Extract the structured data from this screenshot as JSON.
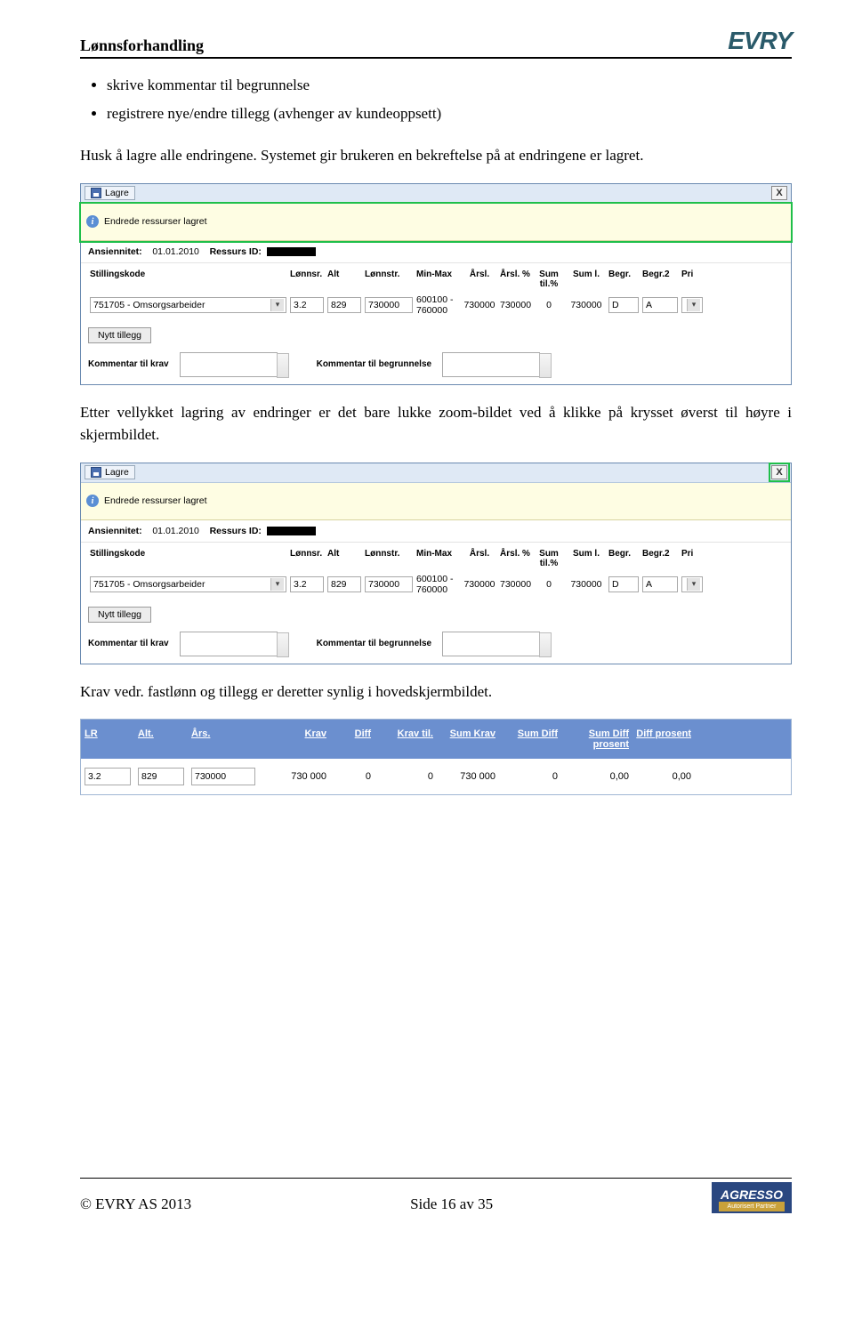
{
  "header": {
    "title": "Lønnsforhandling",
    "logo": "EVRY"
  },
  "bullets": [
    "skrive kommentar til begrunnelse",
    "registrere nye/endre tillegg (avhenger av kundeoppsett)"
  ],
  "paragraphs": {
    "p1": "Husk å lagre alle endringene. Systemet gir brukeren en bekreftelse på at endringene er lagret.",
    "p2": "Etter vellykket lagring av endringer er det bare lukke zoom-bildet ved å klikke på krysset øverst til høyre i skjermbildet.",
    "p3": "Krav vedr. fastlønn og tillegg er deretter synlig i hovedskjermbildet."
  },
  "app": {
    "lagre_label": "Lagre",
    "close_label": "X",
    "msg": "Endrede ressurser lagret",
    "meta": {
      "ansiennitet_label": "Ansiennitet:",
      "ansiennitet_value": "01.01.2010",
      "ressursid_label": "Ressurs ID:"
    },
    "headers": {
      "stillingskode": "Stillingskode",
      "lonnsr": "Lønnsr.",
      "alt": "Alt",
      "lonnstr": "Lønnstr.",
      "minmax": "Min-Max",
      "arsl": "Årsl.",
      "arslp": "Årsl. %",
      "sumtil": "Sum til.%",
      "suml": "Sum l.",
      "begr": "Begr.",
      "begr2": "Begr.2",
      "pri": "Pri"
    },
    "row": {
      "stillingskode": "751705 - Omsorgsarbeider",
      "lonnsr": "3.2",
      "alt": "829",
      "lonnstr": "730000",
      "minmax": "600100 - 760000",
      "arsl": "730000",
      "arslp": "730000",
      "sumtil": "0",
      "suml": "730000",
      "begr": "D",
      "begr2": "A"
    },
    "nytt_tillegg": "Nytt tillegg",
    "kommentar_krav_label": "Kommentar til krav",
    "kommentar_begr_label": "Kommentar til begrunnelse"
  },
  "bluetable": {
    "headers": {
      "lr": "LR",
      "alt": "Alt.",
      "ars": "Års.",
      "krav": "Krav",
      "diff": "Diff",
      "kravtil": "Krav til.",
      "sumkrav": "Sum Krav",
      "sumdiff": "Sum Diff",
      "sumdiffp": "Sum Diff prosent",
      "diffp": "Diff prosent"
    },
    "row": {
      "lr": "3.2",
      "alt": "829",
      "ars": "730000",
      "krav": "730 000",
      "diff": "0",
      "kravtil": "0",
      "sumkrav": "730 000",
      "sumdiff": "0",
      "sumdiffp": "0,00",
      "diffp": "0,00"
    }
  },
  "footer": {
    "copyright": "© EVRY AS 2013",
    "page": "Side 16 av 35",
    "agresso": "AGRESSO",
    "agresso_sub": "Autorisert Partner"
  }
}
